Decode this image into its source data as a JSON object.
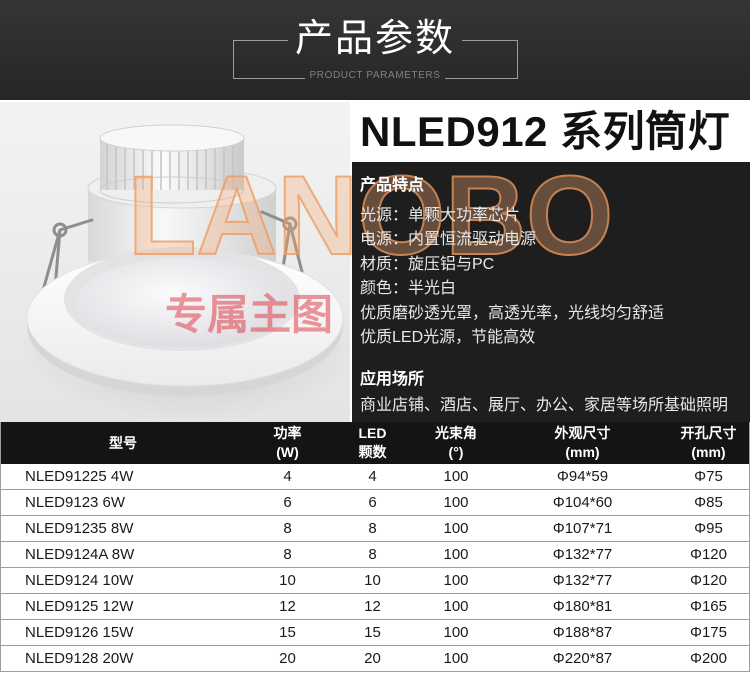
{
  "header": {
    "title": "产品参数",
    "subtitle": "PRODUCT PARAMETERS"
  },
  "watermark": {
    "brand": "LANOBO",
    "text": "专属主图"
  },
  "product": {
    "title": "NLED912 系列筒灯",
    "features_heading": "产品特点",
    "features": [
      "光源：单颗大功率芯片",
      "电源：内置恒流驱动电源",
      "材质：旋压铝与PC",
      "颜色：半光白",
      "优质磨砂透光罩，高透光率，光线均匀舒适",
      "优质LED光源，节能高效"
    ],
    "applications_heading": "应用场所",
    "applications": "商业店铺、酒店、展厅、办公、家居等场所基础照明"
  },
  "table": {
    "headers": [
      [
        "型号"
      ],
      [
        "功率",
        "(W)"
      ],
      [
        "LED",
        "颗数"
      ],
      [
        "光束角",
        "(°)"
      ],
      [
        "外观尺寸",
        "(mm)"
      ],
      [
        "开孔尺寸",
        "(mm)"
      ]
    ],
    "rows": [
      [
        "NLED91225 4W",
        "4",
        "4",
        "100",
        "Φ94*59",
        "Φ75"
      ],
      [
        "NLED9123 6W",
        "6",
        "6",
        "100",
        "Φ104*60",
        "Φ85"
      ],
      [
        "NLED91235 8W",
        "8",
        "8",
        "100",
        "Φ107*71",
        "Φ95"
      ],
      [
        "NLED9124A 8W",
        "8",
        "8",
        "100",
        "Φ132*77",
        "Φ120"
      ],
      [
        "NLED9124 10W",
        "10",
        "10",
        "100",
        "Φ132*77",
        "Φ120"
      ],
      [
        "NLED9125 12W",
        "12",
        "12",
        "100",
        "Φ180*81",
        "Φ165"
      ],
      [
        "NLED9126 15W",
        "15",
        "15",
        "100",
        "Φ188*87",
        "Φ175"
      ],
      [
        "NLED9128 20W",
        "20",
        "20",
        "100",
        "Φ220*87",
        "Φ200"
      ]
    ]
  },
  "colors": {
    "header_bg": "#262626",
    "panel_bg": "#1e1e1e",
    "table_header_bg": "#141414",
    "grid_line": "#9d9d9d",
    "watermark_brand": "#ef9a5c",
    "watermark_red": "#e0424e"
  }
}
